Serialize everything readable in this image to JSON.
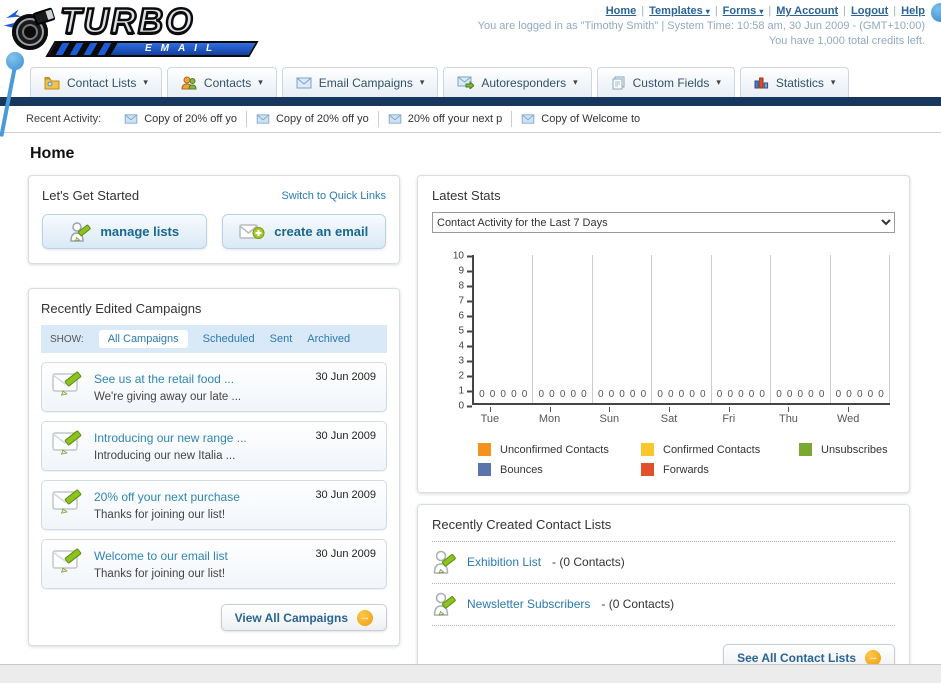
{
  "brand": {
    "name_top": "TURBO",
    "name_bottom": "EMAIL"
  },
  "header": {
    "links": [
      {
        "label": "Home",
        "has_dropdown": false
      },
      {
        "label": "Templates",
        "has_dropdown": true
      },
      {
        "label": "Forms",
        "has_dropdown": true
      },
      {
        "label": "My Account",
        "has_dropdown": false
      },
      {
        "label": "Logout",
        "has_dropdown": false
      },
      {
        "label": "Help",
        "has_dropdown": false
      }
    ],
    "login_text": "You are logged in as \"Timothy Smith\" | System Time: 10:58 am, 30 Jun 2009 - (GMT+10:00)",
    "credits_text": "You have 1,000 total credits left."
  },
  "nav": {
    "tabs": [
      {
        "label": "Contact Lists"
      },
      {
        "label": "Contacts"
      },
      {
        "label": "Email Campaigns"
      },
      {
        "label": "Autoresponders"
      },
      {
        "label": "Custom Fields"
      },
      {
        "label": "Statistics"
      }
    ]
  },
  "recent_activity": {
    "label": "Recent Activity:",
    "items": [
      {
        "text": "Copy of 20% off yo"
      },
      {
        "text": "Copy of 20% off yo"
      },
      {
        "text": "20% off your next p"
      },
      {
        "text": "Copy of Welcome to"
      }
    ]
  },
  "page_title": "Home",
  "get_started": {
    "title": "Let's Get Started",
    "switch_link": "Switch to Quick Links",
    "manage_lists_label": "manage lists",
    "create_email_label": "create an email"
  },
  "campaigns": {
    "title": "Recently Edited Campaigns",
    "show_label": "SHOW:",
    "filters": [
      {
        "label": "All Campaigns",
        "active": true
      },
      {
        "label": "Scheduled",
        "active": false
      },
      {
        "label": "Sent",
        "active": false
      },
      {
        "label": "Archived",
        "active": false
      }
    ],
    "items": [
      {
        "title": "See us at the retail food ...",
        "subtitle": "We're giving away our late ...",
        "date": "30 Jun 2009"
      },
      {
        "title": "Introducing our new range ...",
        "subtitle": "Introducing our new Italia ...",
        "date": "30 Jun 2009"
      },
      {
        "title": "20% off your next purchase",
        "subtitle": "Thanks for joining our list!",
        "date": "30 Jun 2009"
      },
      {
        "title": "Welcome to our email list",
        "subtitle": "Thanks for joining our list!",
        "date": "30 Jun 2009"
      }
    ],
    "view_all_label": "View All Campaigns"
  },
  "stats": {
    "title": "Latest Stats",
    "selector_value": "Contact Activity for the Last 7 Days"
  },
  "chart_data": {
    "type": "bar",
    "title": "Contact Activity for the Last 7 Days",
    "categories": [
      "Tue",
      "Mon",
      "Sun",
      "Sat",
      "Fri",
      "Thu",
      "Wed"
    ],
    "series": [
      {
        "name": "Unconfirmed Contacts",
        "color": "#f5921e",
        "values": [
          0,
          0,
          0,
          0,
          0,
          0,
          0
        ]
      },
      {
        "name": "Confirmed Contacts",
        "color": "#fbc72d",
        "values": [
          0,
          0,
          0,
          0,
          0,
          0,
          0
        ]
      },
      {
        "name": "Unsubscribes",
        "color": "#7aa831",
        "values": [
          0,
          0,
          0,
          0,
          0,
          0,
          0
        ]
      },
      {
        "name": "Bounces",
        "color": "#5a74ac",
        "values": [
          0,
          0,
          0,
          0,
          0,
          0,
          0
        ]
      },
      {
        "name": "Forwards",
        "color": "#e2502b",
        "values": [
          0,
          0,
          0,
          0,
          0,
          0,
          0
        ]
      }
    ],
    "ylim": [
      0,
      10
    ],
    "ytick_step": 1,
    "grid": "vertical",
    "legend_position": "bottom",
    "xlabel": "",
    "ylabel": ""
  },
  "contact_lists": {
    "title": "Recently Created Contact Lists",
    "items": [
      {
        "name": "Exhibition List",
        "suffix": "- (0 Contacts)"
      },
      {
        "name": "Newsletter Subscribers",
        "suffix": "- (0 Contacts)"
      }
    ],
    "see_all_label": "See All Contact Lists"
  },
  "colors": {
    "navy_bar": "#17375e",
    "link_blue": "#2a7ab0",
    "header_link": "#2a6496",
    "button_text": "#1a678f",
    "arrow_orange": "#ee9b0a"
  }
}
